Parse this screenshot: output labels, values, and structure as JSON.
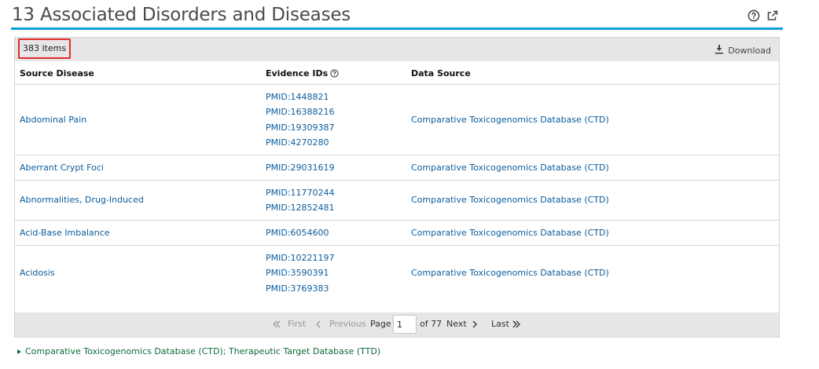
{
  "section": {
    "title": "13 Associated Disorders and Diseases",
    "icons": [
      "help-icon",
      "external-link-icon"
    ]
  },
  "table": {
    "item_count": "383 items",
    "download_label": "Download",
    "columns": [
      "Source Disease",
      "Evidence IDs",
      "Data Source"
    ],
    "rows": [
      {
        "disease": "Abdominal Pain",
        "ids": [
          "PMID:1448821",
          "PMID:16388216",
          "PMID:19309387",
          "PMID:4270280"
        ],
        "source": "Comparative Toxicogenomics Database (CTD)"
      },
      {
        "disease": "Aberrant Crypt Foci",
        "ids": [
          "PMID:29031619"
        ],
        "source": "Comparative Toxicogenomics Database (CTD)"
      },
      {
        "disease": "Abnormalities, Drug-Induced",
        "ids": [
          "PMID:11770244",
          "PMID:12852481"
        ],
        "source": "Comparative Toxicogenomics Database (CTD)"
      },
      {
        "disease": "Acid-Base Imbalance",
        "ids": [
          "PMID:6054600"
        ],
        "source": "Comparative Toxicogenomics Database (CTD)"
      },
      {
        "disease": "Acidosis",
        "ids": [
          "PMID:10221197",
          "PMID:3590391",
          "PMID:3769383"
        ],
        "source": "Comparative Toxicogenomics Database (CTD)"
      }
    ]
  },
  "pager": {
    "first": "First",
    "previous": "Previous",
    "page_label": "Page",
    "page_value": "1",
    "of_label": "of 77",
    "next": "Next",
    "last": "Last"
  },
  "footer": {
    "sources": "Comparative Toxicogenomics Database (CTD); Therapeutic Target Database (TTD)"
  },
  "colors": {
    "accent": "#00a2d9",
    "link": "#0a5c9c",
    "highlight": "#e32b2b",
    "footer_link": "#0e6b3a"
  }
}
